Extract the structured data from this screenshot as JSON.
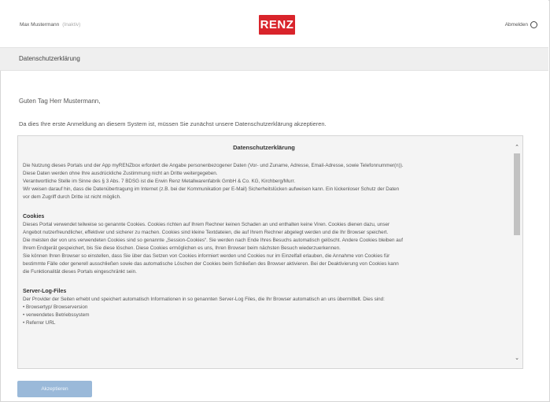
{
  "header": {
    "user_name": "Max Mustermann",
    "user_status": "(Inaktiv)",
    "logo_text": "RENZ",
    "logout_label": "Abmelden"
  },
  "titlebar": {
    "title": "Datenschutzerklärung"
  },
  "greeting": "Guten Tag Herr Mustermann,",
  "intro": "Da dies Ihre erste Anmeldung an diesem System ist, müssen Sie zunächst unsere Datenschutzerklärung akzeptieren.",
  "policy": {
    "title": "Datenschutzerklärung",
    "intro_lines": [
      "Die Nutzung dieses Portals und der App myRENZbox erfordert die Angabe personenbezogener Daten (Vor- und Zuname, Adresse, Email-Adresse, sowie Telefonnummer(n)).",
      "Diese Daten werden ohne Ihre ausdrückliche Zustimmung nicht an Dritte weitergegeben.",
      "Verantwortliche Stelle im Sinne des § 3 Abs. 7 BDSG ist die Erwin Renz Metallwarenfabrik GmbH & Co. KG, Kirchberg/Murr.",
      "Wir weisen darauf hin, dass die Datenübertragung im Internet (z.B. bei der Kommunikation per E-Mail) Sicherheitslücken aufweisen kann. Ein lückenloser Schutz der Daten",
      "vor dem Zugriff durch Dritte ist nicht möglich."
    ],
    "cookies_heading": "Cookies",
    "cookies_lines": [
      "Dieses Portal verwendet teilweise so genannte Cookies. Cookies richten auf Ihrem Rechner keinen Schaden an und enthalten keine Viren. Cookies dienen dazu, unser",
      "Angebot nutzerfreundlicher, effektiver und sicherer zu machen. Cookies sind kleine Textdateien, die auf Ihrem Rechner abgelegt werden und die Ihr Browser speichert.",
      "Die meisten der von uns verwendeten Cookies sind so genannte „Session-Cookies“. Sie werden nach Ende Ihres Besuchs automatisch gelöscht. Andere Cookies bleiben auf",
      "Ihrem Endgerät gespeichert, bis Sie diese löschen. Diese Cookies ermöglichen es uns, Ihren Browser beim nächsten Besuch wiederzuerkennen.",
      "Sie können Ihren Browser so einstellen, dass Sie über das Setzen von Cookies informiert werden und Cookies nur im Einzelfall erlauben, die Annahme von Cookies für",
      "bestimmte Fälle oder generell ausschließen sowie das automatische Löschen der Cookies beim Schließen des Browser aktivieren. Bei der Deaktivierung von Cookies kann",
      "die Funktionalität dieses Portals eingeschränkt sein."
    ],
    "server_heading": "Server-Log-Files",
    "server_lines": [
      "Der Provider der Seiten erhebt und speichert automatisch Informationen in so genannten Server-Log Files, die Ihr Browser automatisch an uns übermittelt. Dies sind:",
      "• Browsertyp/ Browserversion",
      "• verwendetes Betriebssystem",
      "• Referrer URL"
    ]
  },
  "accept_label": "Akzeptieren",
  "colors": {
    "brand": "#d9242b",
    "accept_button": "#9ab9d9",
    "titlebar_bg": "#efefef"
  }
}
